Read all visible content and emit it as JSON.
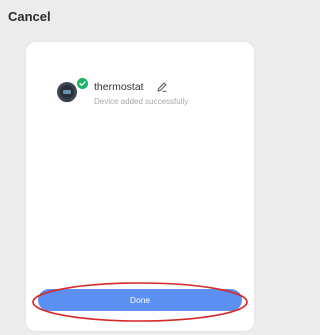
{
  "header": {
    "cancel_label": "Cancel"
  },
  "device": {
    "name": "thermostat",
    "status": "Device added successfully",
    "icon": "thermostat-device-icon",
    "badge_icon": "check-badge-icon",
    "edit_icon": "edit-pencil-icon"
  },
  "footer": {
    "done_label": "Done"
  },
  "colors": {
    "background": "#ececec",
    "card": "#ffffff",
    "primary": "#5b8ff2",
    "success": "#1fb36a",
    "annotation": "#d62828"
  }
}
